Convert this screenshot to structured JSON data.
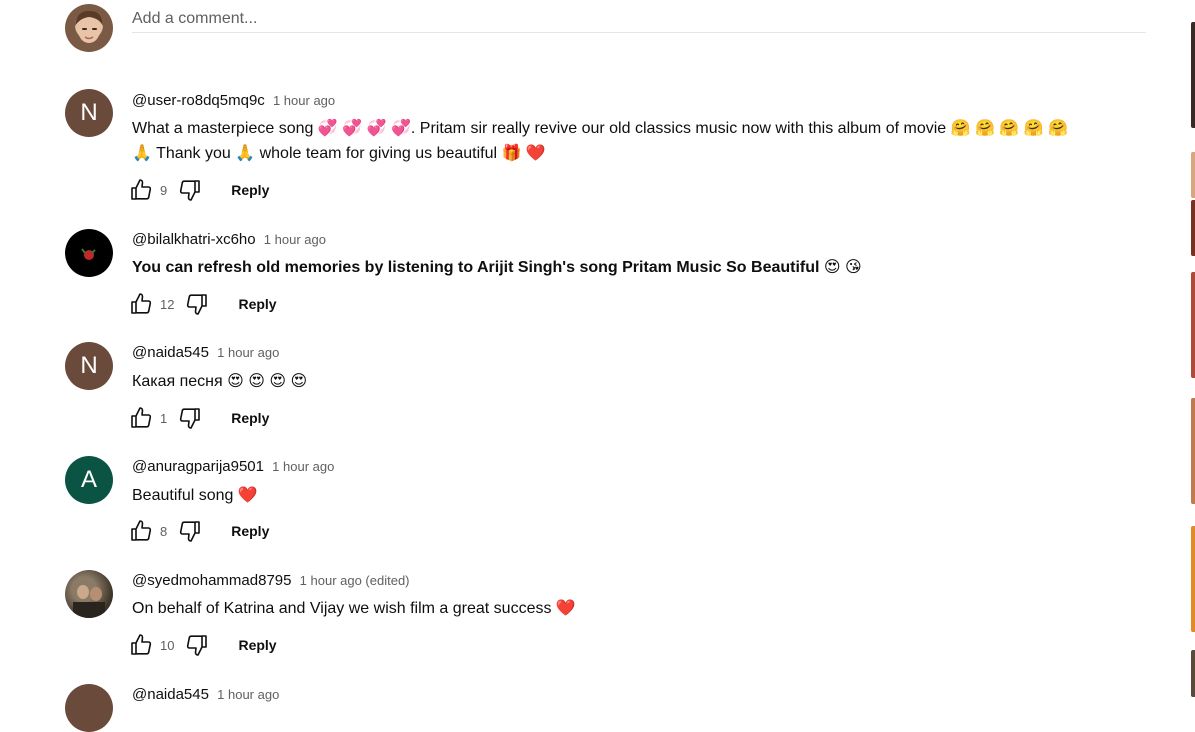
{
  "add_comment": {
    "placeholder": "Add a comment..."
  },
  "comments": [
    {
      "author": "@user-ro8dq5mq9c",
      "time": "1 hour ago",
      "avatar_letter": "N",
      "avatar_color": "#6a4a3a",
      "text": "What a masterpiece song 💞 💞 💞 💞. Pritam sir really revive our old classics music now with this album of movie 🤗 🤗 🤗 🤗 🤗\n🙏 Thank you 🙏 whole team for giving us beautiful 🎁 ❤️",
      "likes": "9",
      "reply_label": "Reply"
    },
    {
      "author": "@bilalkhatri-xc6ho",
      "time": "1 hour ago",
      "avatar_letter": "",
      "avatar_color": "#000000",
      "text": "You can refresh old memories by listening to Arijit Singh's song Pritam Music So Beautiful 😍 😘",
      "likes": "12",
      "reply_label": "Reply"
    },
    {
      "author": "@naida545",
      "time": "1 hour ago",
      "avatar_letter": "N",
      "avatar_color": "#6a4a3a",
      "text": "Какая песня 😍 😍 😍 😍",
      "likes": "1",
      "reply_label": "Reply"
    },
    {
      "author": "@anuragparija9501",
      "time": "1 hour ago",
      "avatar_letter": "A",
      "avatar_color": "#0b5343",
      "text": "Beautiful song ❤️",
      "likes": "8",
      "reply_label": "Reply"
    },
    {
      "author": "@syedmohammad8795",
      "time": "1 hour ago (edited)",
      "avatar_letter": "",
      "avatar_color": "#4a4036",
      "text": "On behalf of Katrina and Vijay we wish film a great success ❤️",
      "likes": "10",
      "reply_label": "Reply"
    },
    {
      "author": "@naida545",
      "time": "1 hour ago",
      "avatar_letter": "",
      "avatar_color": "#6a4a3a",
      "text": "",
      "likes": "",
      "reply_label": ""
    }
  ],
  "colors": {
    "text_primary": "#0f0f0f",
    "text_secondary": "#606060",
    "divider": "#e5e5e5"
  },
  "icons": {
    "like": "thumbs-up-icon",
    "dislike": "thumbs-down-icon"
  }
}
